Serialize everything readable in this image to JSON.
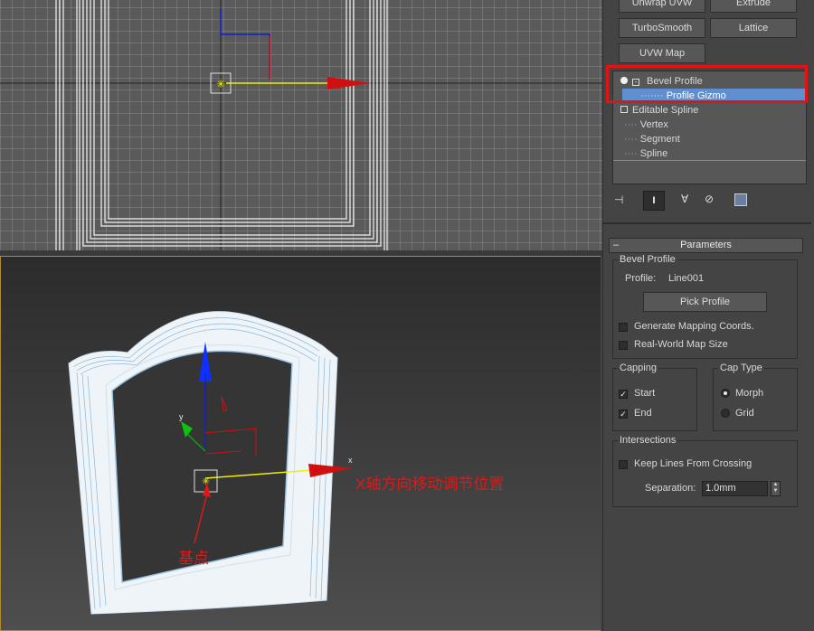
{
  "modifier_buttons": [
    "Unwrap UVW",
    "Extrude",
    "TurboSmooth",
    "Lattice",
    "UVW Map"
  ],
  "stack": {
    "bevel_profile": "Bevel Profile",
    "profile_gizmo": "Profile Gizmo",
    "editable_spline": "Editable Spline",
    "vertex": "Vertex",
    "segment": "Segment",
    "spline": "Spline"
  },
  "parameters": {
    "rollout_title": "Parameters",
    "rollout_toggle": "–",
    "bevel_profile_group": "Bevel Profile",
    "profile_label": "Profile:",
    "profile_value": "Line001",
    "pick_profile": "Pick Profile",
    "generate_mapping": "Generate Mapping Coords.",
    "real_world_map": "Real-World Map Size",
    "capping_group": "Capping",
    "start": "Start",
    "end": "End",
    "cap_type_group": "Cap Type",
    "morph": "Morph",
    "grid": "Grid",
    "intersections_group": "Intersections",
    "keep_lines": "Keep Lines From Crossing",
    "separation_label": "Separation:",
    "separation_value": "1.0mm",
    "checked_mark": "✓"
  },
  "axis_labels": {
    "z": "z",
    "x": "x",
    "y": "y"
  },
  "annotations": {
    "x_move": "X轴方向移动调节位置",
    "pivot": "基点"
  },
  "colors": {
    "highlight_red": "#e01414",
    "selection_blue": "#5f8fd0",
    "axis_x": "#d01010",
    "axis_y": "#10a010",
    "axis_z": "#1020d0",
    "active_gizmo_axis": "#f0f000"
  }
}
